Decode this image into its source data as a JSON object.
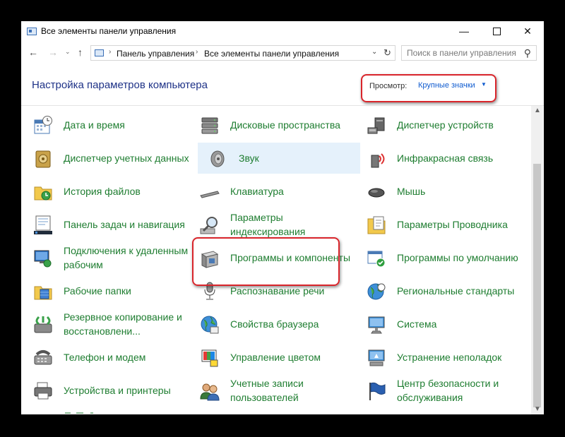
{
  "window": {
    "title": "Все элементы панели управления",
    "controls": {
      "minimize": "—",
      "close": "✕"
    }
  },
  "nav": {
    "back": "←",
    "forward": "→",
    "recent": "⌄",
    "up": "↑",
    "address": {
      "sep1": "›",
      "crumb1": "Панель управления",
      "sep2": "›",
      "crumb2": "Все элементы панели управления",
      "dropdown": "⌄",
      "refresh": "↻"
    },
    "search": {
      "placeholder": "Поиск в панели управления",
      "value": ""
    }
  },
  "header": {
    "title": "Настройка параметров компьютера",
    "view_label": "Просмотр:",
    "view_value": "Крупные значки",
    "view_arrow": "▼"
  },
  "items": [
    {
      "label": "Дата и время",
      "icon": "calendar-clock-icon"
    },
    {
      "label": "Дисковые пространства",
      "icon": "storage-stack-icon"
    },
    {
      "label": "Диспетчер устройств",
      "icon": "device-manager-icon"
    },
    {
      "label": "Диспетчер учетных данных",
      "icon": "vault-icon"
    },
    {
      "label": "Звук",
      "icon": "speaker-icon"
    },
    {
      "label": "Инфракрасная связь",
      "icon": "infrared-icon"
    },
    {
      "label": "История файлов",
      "icon": "file-history-icon"
    },
    {
      "label": "Клавиатура",
      "icon": "keyboard-icon"
    },
    {
      "label": "Мышь",
      "icon": "mouse-icon"
    },
    {
      "label": "Панель задач и навигация",
      "icon": "taskbar-icon"
    },
    {
      "label": "Параметры индексирования",
      "icon": "indexing-icon"
    },
    {
      "label": "Параметры Проводника",
      "icon": "folder-options-icon"
    },
    {
      "label": "Подключения к удаленным рабочим",
      "icon": "remote-desktop-icon"
    },
    {
      "label": "Программы и компоненты",
      "icon": "programs-icon"
    },
    {
      "label": "Программы по умолчанию",
      "icon": "default-programs-icon"
    },
    {
      "label": "Рабочие папки",
      "icon": "work-folders-icon"
    },
    {
      "label": "Распознавание речи",
      "icon": "microphone-icon"
    },
    {
      "label": "Региональные стандарты",
      "icon": "globe-clock-icon"
    },
    {
      "label": "Резервное копирование и восстановлени...",
      "icon": "backup-icon"
    },
    {
      "label": "Свойства браузера",
      "icon": "browser-globe-icon"
    },
    {
      "label": "Система",
      "icon": "computer-icon"
    },
    {
      "label": "Телефон и модем",
      "icon": "phone-modem-icon"
    },
    {
      "label": "Управление цветом",
      "icon": "color-management-icon"
    },
    {
      "label": "Устранение неполадок",
      "icon": "troubleshoot-icon"
    },
    {
      "label": "Устройства и принтеры",
      "icon": "printer-icon"
    },
    {
      "label": "Учетные записи пользователей",
      "icon": "users-icon"
    },
    {
      "label": "Центр безопасности и обслуживания",
      "icon": "flag-icon"
    }
  ],
  "scroll": {
    "up": "▲",
    "down": "▼"
  },
  "colors": {
    "link_green": "#1e7d30",
    "title_blue": "#1e3287",
    "accent_blue": "#0f5bcf",
    "highlight_red": "#d9252b",
    "hover_bg": "#e5f1fb"
  }
}
